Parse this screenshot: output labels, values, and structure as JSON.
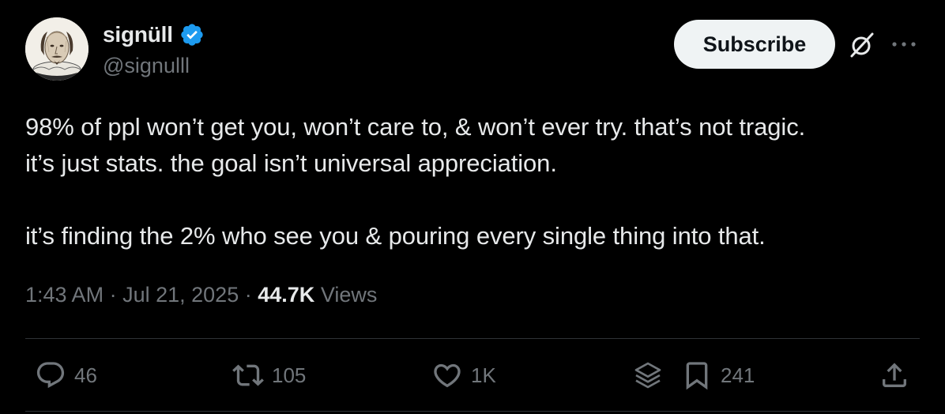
{
  "author": {
    "display_name": "signüll",
    "handle": "@signulll",
    "verified": true,
    "verified_color": "#1d9bf0"
  },
  "header": {
    "subscribe_label": "Subscribe",
    "icons": [
      "grok-icon",
      "more-icon"
    ]
  },
  "tweet": {
    "lines": [
      "98% of ppl won’t get you, won’t care to, & won’t ever try. that’s not tragic.",
      "it’s just stats. the goal isn’t universal appreciation.",
      "it’s finding the 2% who see you & pouring every single thing into that."
    ]
  },
  "meta": {
    "time": "1:43 AM",
    "separator": "·",
    "date": "Jul 21, 2025",
    "views_count": "44.7K",
    "views_label": "Views"
  },
  "actions": {
    "replies": "46",
    "reposts": "105",
    "likes": "1K",
    "bookmarks": "241",
    "icons": [
      "reply-icon",
      "repost-icon",
      "like-icon",
      "layers-icon",
      "bookmark-icon",
      "share-icon"
    ]
  },
  "colors": {
    "background": "#000000",
    "text_primary": "#e7e9ea",
    "text_secondary": "#71767b",
    "divider": "#2f3336",
    "button_bg": "#eff3f4"
  }
}
